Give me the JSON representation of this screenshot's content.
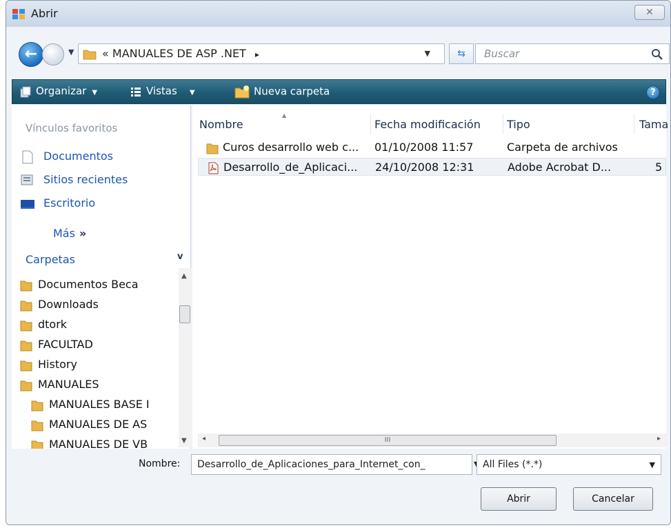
{
  "window": {
    "title": "Abrir"
  },
  "address": {
    "prefix": "«",
    "path": "MANUALES DE ASP .NET",
    "sep": "▸"
  },
  "search": {
    "placeholder": "Buscar"
  },
  "toolbar": {
    "organize": "Organizar",
    "views": "Vistas",
    "new_folder": "Nueva carpeta"
  },
  "sidebar": {
    "favorites_header": "Vínculos favoritos",
    "favorites": [
      {
        "label": "Documentos",
        "icon": "document-icon"
      },
      {
        "label": "Sitios recientes",
        "icon": "recent-sites-icon"
      },
      {
        "label": "Escritorio",
        "icon": "desktop-icon"
      }
    ],
    "more": "Más",
    "folders_header": "Carpetas",
    "tree": [
      "Documentos Beca",
      "Downloads",
      "dtork",
      "FACULTAD",
      "History",
      "MANUALES",
      "MANUALES BASE I",
      "MANUALES DE AS",
      "MANUALES DE VB"
    ]
  },
  "filelist": {
    "columns": [
      "Nombre",
      "Fecha modificación",
      "Tipo",
      "Tama"
    ],
    "rows": [
      {
        "name": "Curos desarrollo web c...",
        "date": "01/10/2008 11:57",
        "type": "Carpeta de archivos",
        "size": "",
        "icon": "folder-icon"
      },
      {
        "name": "Desarrollo_de_Aplicaci...",
        "date": "24/10/2008 12:31",
        "type": "Adobe Acrobat D...",
        "size": "5",
        "icon": "pdf-icon"
      }
    ],
    "hscroll_grip": "III"
  },
  "bottom": {
    "name_label": "Nombre:",
    "name_value": "Desarrollo_de_Aplicaciones_para_Internet_con_",
    "filter_value": "All Files (*.*)",
    "open_label": "Abrir",
    "cancel_label": "Cancelar"
  },
  "colors": {
    "toolbar": "#1f5b74",
    "link": "#1b55b5",
    "folder": "#e8b64a"
  }
}
